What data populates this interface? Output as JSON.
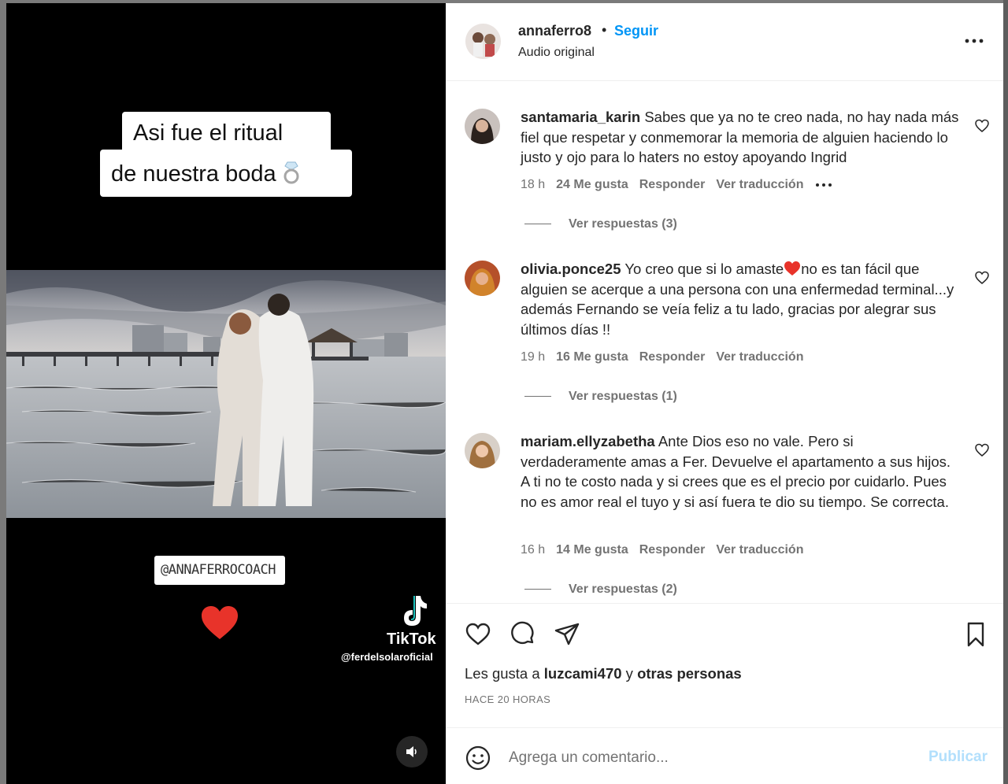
{
  "media": {
    "caption_line1": "Asi fue el ritual",
    "caption_line2": "de nuestra boda",
    "ring_icon": "ring-icon",
    "handle_sticker": "@ANNAFERROCOACH",
    "heart_icon": "heart-icon",
    "watermark_brand": "TikTok",
    "watermark_handle": "@ferdelsolaroficial",
    "sound_icon": "speaker-icon"
  },
  "post": {
    "author": "annaferro8",
    "separator": "•",
    "follow_label": "Seguir",
    "audio": "Audio original",
    "more_icon": "more-horizontal-icon"
  },
  "comments": [
    {
      "user": "santamaria_karin",
      "text": "Sabes que ya no te creo nada, no hay nada más fiel que respetar y conmemorar la memoria de alguien haciendo lo justo y ojo para lo haters no estoy apoyando Ingrid",
      "time": "18 h",
      "likes": "24 Me gusta",
      "reply": "Responder",
      "translate": "Ver traducción",
      "replies": "Ver respuestas (3)"
    },
    {
      "user": "olivia.ponce25",
      "text_before": "Yo creo que si lo amaste",
      "text_after": "no es tan fácil que alguien se acerque a una persona con una enfermedad terminal...y además Fernando se veía feliz a tu lado, gracias por alegrar sus últimos días !!",
      "time": "19 h",
      "likes": "16 Me gusta",
      "reply": "Responder",
      "translate": "Ver traducción",
      "replies": "Ver respuestas (1)"
    },
    {
      "user": "mariam.ellyzabetha",
      "text": "Ante Dios eso no vale. Pero si verdaderamente amas a Fer. Devuelve el apartamento a sus hijos. A ti no te costo nada y si crees que es el precio por cuidarlo. Pues no es amor real el tuyo y si así fuera te dio su tiempo. Se correcta.",
      "time": "16 h",
      "likes": "14 Me gusta",
      "reply": "Responder",
      "translate": "Ver traducción",
      "replies": "Ver respuestas (2)"
    }
  ],
  "footer": {
    "likes_prefix": "Les gusta a",
    "likes_user": "luzcami470",
    "likes_join": "y",
    "likes_others": "otras personas",
    "time": "HACE 20 HORAS",
    "comment_placeholder": "Agrega un comentario...",
    "publish_label": "Publicar"
  },
  "colors": {
    "accent": "#0095f6",
    "publish_disabled": "#b2dffc",
    "heart_red": "#e8332a"
  }
}
